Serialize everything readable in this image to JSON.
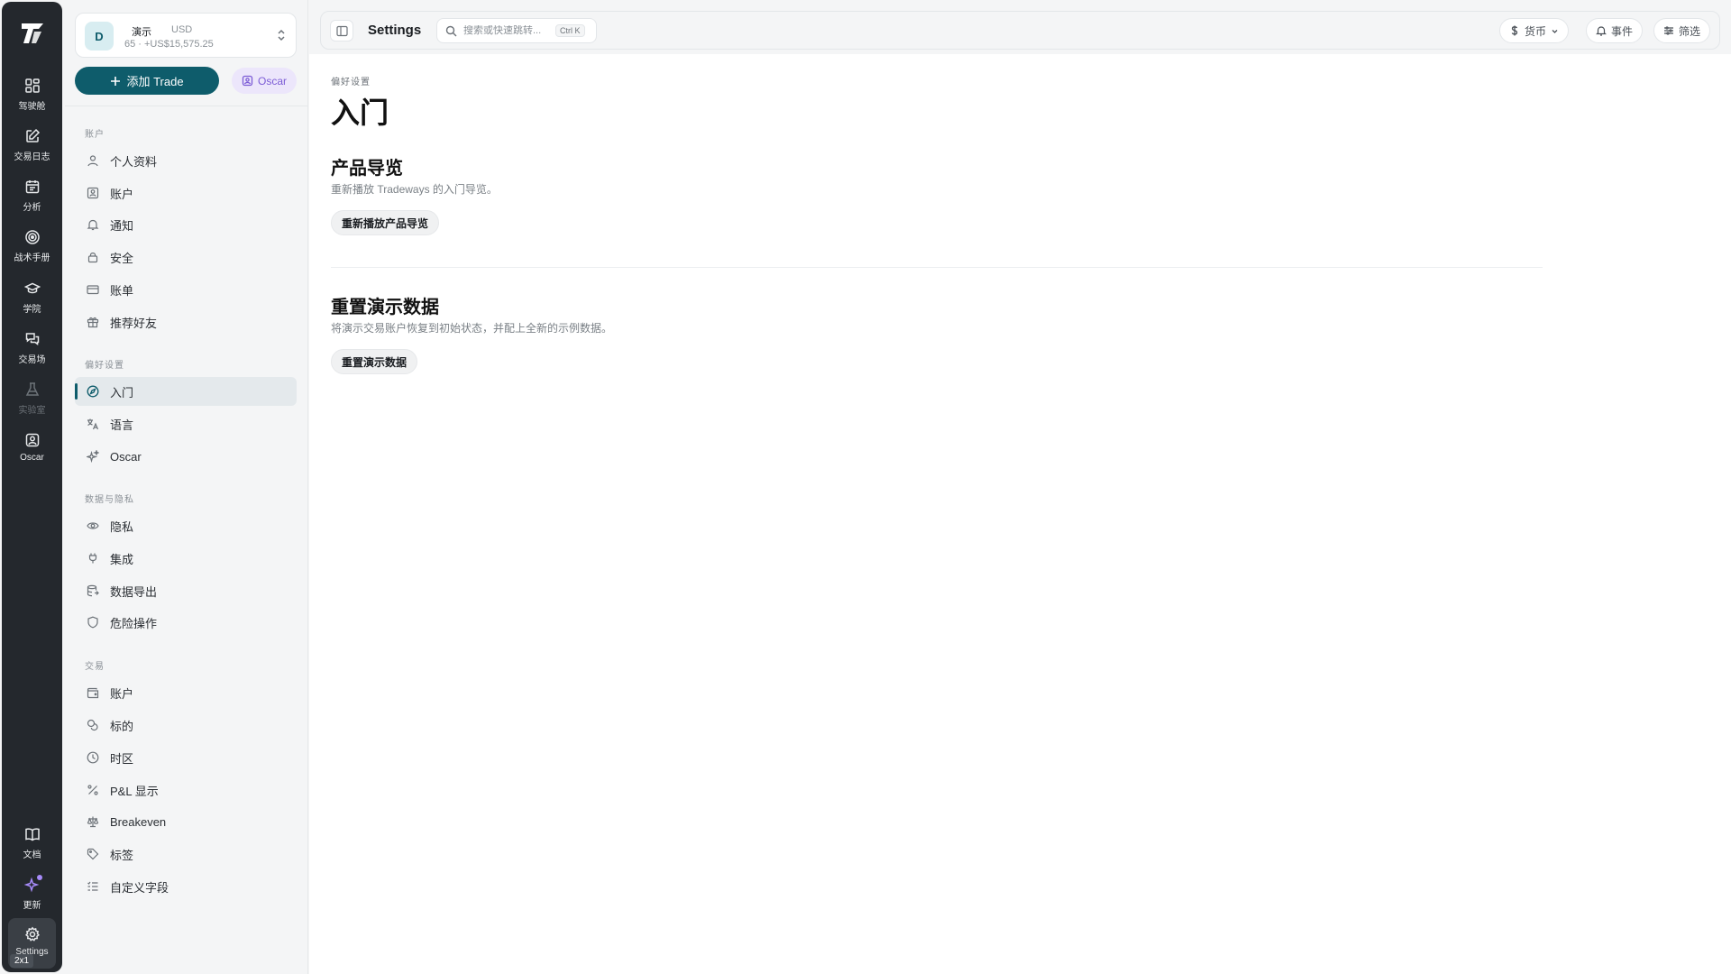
{
  "rail": {
    "items": [
      {
        "label": "驾驶舱",
        "icon": "dashboard-grid-icon"
      },
      {
        "label": "交易日志",
        "icon": "journal-edit-icon"
      },
      {
        "label": "分析",
        "icon": "calendar-icon"
      },
      {
        "label": "战术手册",
        "icon": "target-icon"
      },
      {
        "label": "学院",
        "icon": "graduation-cap-icon"
      },
      {
        "label": "交易场",
        "icon": "chat-bubbles-icon"
      },
      {
        "label": "实验室",
        "icon": "flask-icon"
      },
      {
        "label": "Oscar",
        "icon": "oscar-bot-icon"
      }
    ],
    "bottom": [
      {
        "label": "文档",
        "icon": "book-icon"
      },
      {
        "label": "更新",
        "icon": "sparkle-icon"
      }
    ],
    "settings_label": "Settings",
    "zoom_badge": "2x1"
  },
  "account": {
    "avatar_letter": "D",
    "name": "演示",
    "currency": "USD",
    "summary": "65 · +US$15,575.25"
  },
  "actions": {
    "add_trade": "添加 Trade",
    "oscar": "Oscar"
  },
  "sidebar": {
    "sections": [
      {
        "title": "账户",
        "items": [
          {
            "label": "个人资料",
            "icon": "user-icon"
          },
          {
            "label": "账户",
            "icon": "id-card-icon"
          },
          {
            "label": "通知",
            "icon": "bell-icon"
          },
          {
            "label": "安全",
            "icon": "lock-icon"
          },
          {
            "label": "账单",
            "icon": "credit-card-icon"
          },
          {
            "label": "推荐好友",
            "icon": "gift-icon"
          }
        ]
      },
      {
        "title": "偏好设置",
        "items": [
          {
            "label": "入门",
            "icon": "compass-icon",
            "active": true
          },
          {
            "label": "语言",
            "icon": "translate-icon"
          },
          {
            "label": "Oscar",
            "icon": "sparkles-icon"
          }
        ]
      },
      {
        "title": "数据与隐私",
        "items": [
          {
            "label": "隐私",
            "icon": "eye-icon"
          },
          {
            "label": "集成",
            "icon": "plug-icon"
          },
          {
            "label": "数据导出",
            "icon": "database-export-icon"
          },
          {
            "label": "危险操作",
            "icon": "shield-icon"
          }
        ]
      },
      {
        "title": "交易",
        "items": [
          {
            "label": "账户",
            "icon": "wallet-icon"
          },
          {
            "label": "标的",
            "icon": "coins-icon"
          },
          {
            "label": "时区",
            "icon": "clock-icon"
          },
          {
            "label": "P&L 显示",
            "icon": "percent-icon"
          },
          {
            "label": "Breakeven",
            "icon": "scale-icon"
          },
          {
            "label": "标签",
            "icon": "tag-icon"
          },
          {
            "label": "自定义字段",
            "icon": "list-check-icon"
          }
        ]
      }
    ]
  },
  "topbar": {
    "title": "Settings",
    "search_placeholder": "搜索或快速跳转...",
    "search_shortcut": "Ctrl K",
    "currency_label": "货币",
    "events_label": "事件",
    "filter_label": "筛选"
  },
  "page": {
    "breadcrumb": "偏好设置",
    "title": "入门",
    "tour": {
      "title": "产品导览",
      "description": "重新播放 Tradeways 的入门导览。",
      "button": "重新播放产品导览"
    },
    "reset": {
      "title": "重置演示数据",
      "description": "将演示交易账户恢复到初始状态，并配上全新的示例数据。",
      "button": "重置演示数据"
    }
  },
  "colors": {
    "brand": "#0e5c6b",
    "rail_bg": "#24282d",
    "oscar_accent": "#7c5cd6"
  }
}
